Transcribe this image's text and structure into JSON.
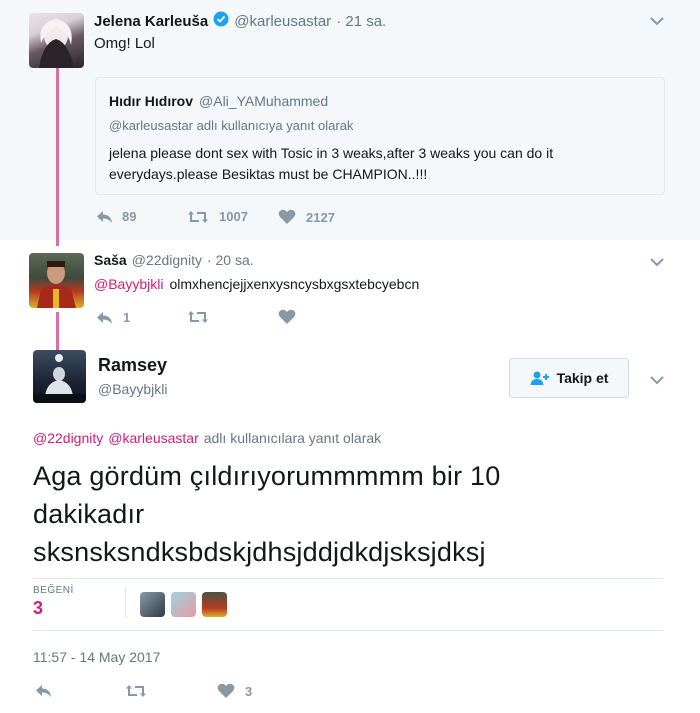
{
  "tweet1": {
    "name": "Jelena Karleuša",
    "handle": "@karleusastar",
    "time": "· 21 sa.",
    "text": "Omg! Lol",
    "quoted": {
      "name": "Hıdır Hıdırov",
      "handle": "@Ali_YAMuhammed",
      "reply_to": "@karleusastar adlı kullanıcıya yanıt olarak",
      "text_line1": "jelena please dont sex with Tosic in 3 weaks,after 3 weaks you can do it",
      "text_line2": "everydays.please Besiktas must be CHAMPION..!!!"
    },
    "replies": "89",
    "retweets": "1007",
    "likes": "2127"
  },
  "tweet2": {
    "name": "Saša",
    "handle": "@22dignity",
    "time": "· 20 sa.",
    "mention": "@Bayybjkli",
    "text": "olmxhencjejjxenxysncysbxgsxtebcyebcn",
    "replies": "1"
  },
  "tweet3": {
    "name": "Ramsey",
    "handle": "@Bayybjkli",
    "follow_label": "Takip et",
    "reply_mention1": "@22dignity",
    "reply_mention2": "@karleusastar",
    "reply_suffix": "adlı kullanıcılara yanıt olarak",
    "text_line1": "Aga gördüm çıldırıyorummmmm bir 10",
    "text_line2": "dakikadır",
    "text_line3": "sksnsksndksbdskjdhsjddjdkdjsksjdksj",
    "likes_label": "BEĞENİ",
    "likes_count": "3",
    "timestamp": "11:57 - 14 May 2017",
    "footer_likes": "3"
  },
  "colors": {
    "thread_line": "#d86fa5",
    "link": "#d51c73",
    "verified": "#1da1f2",
    "icon_gray": "#8899a6"
  }
}
